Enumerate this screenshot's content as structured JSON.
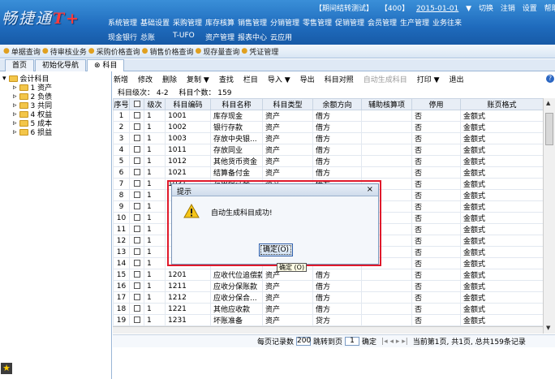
{
  "header": {
    "logo_text": "畅捷通",
    "logo_suffix": "T+",
    "info": [
      "【期间结转测试】",
      "【400】",
      "2015-01-01",
      "▼",
      "切换",
      "注销",
      "设置",
      "帮助"
    ],
    "menu_row1": [
      "系统管理",
      "基础设置",
      "采购管理",
      "库存核算",
      "销售管理",
      "分销管理",
      "零售管理",
      "促销管理",
      "会员管理",
      "生产管理",
      "业务往来"
    ],
    "menu_row2": [
      "现金银行",
      "总账",
      "T-UFO",
      "资产管理",
      "报表中心",
      "云应用"
    ]
  },
  "quickbar": [
    "单据查询",
    "待审核业务",
    "采购价格查询",
    "销售价格查询",
    "现存量查询",
    "凭证管理"
  ],
  "tabs": [
    "首页",
    "初始化导航",
    "科目"
  ],
  "tree": {
    "root": "会计科目",
    "items": [
      "1 资产",
      "2 负债",
      "3 共同",
      "4 权益",
      "5 成本",
      "6 损益"
    ]
  },
  "toolbar": {
    "items": [
      "新增",
      "修改",
      "删除",
      "复制 ▼",
      "查找",
      "栏目",
      "导入 ▼",
      "导出",
      "科目对照",
      "自动生成科目",
      "打印 ▼",
      "退出"
    ],
    "help_label": "?"
  },
  "summary": {
    "levels": "科目级次： 4-2",
    "count": "科目个数： 159"
  },
  "table": {
    "columns": [
      "序号",
      "",
      "级次",
      "科目编码",
      "科目名称",
      "科目类型",
      "余额方向",
      "辅助核算项",
      "停用",
      "账页格式"
    ],
    "rows": [
      [
        "1",
        "1",
        "1001",
        "库存现金",
        "资产",
        "借方",
        "",
        "否",
        "金额式"
      ],
      [
        "2",
        "1",
        "1002",
        "银行存款",
        "资产",
        "借方",
        "",
        "否",
        "金额式"
      ],
      [
        "3",
        "1",
        "1003",
        "存放中央银...",
        "资产",
        "借方",
        "",
        "否",
        "金额式"
      ],
      [
        "4",
        "1",
        "1011",
        "存放同业",
        "资产",
        "借方",
        "",
        "否",
        "金额式"
      ],
      [
        "5",
        "1",
        "1012",
        "其他货币资金",
        "资产",
        "借方",
        "",
        "否",
        "金额式"
      ],
      [
        "6",
        "1",
        "1021",
        "结算备付金",
        "资产",
        "借方",
        "",
        "否",
        "金额式"
      ],
      [
        "7",
        "1",
        "1031",
        "存出保证金",
        "资产",
        "借方",
        "",
        "否",
        "金额式"
      ],
      [
        "8",
        "1",
        "",
        "",
        "",
        "",
        "",
        "否",
        "金额式"
      ],
      [
        "9",
        "1",
        "",
        "",
        "",
        "",
        "",
        "否",
        "金额式"
      ],
      [
        "10",
        "1",
        "",
        "",
        "",
        "",
        "",
        "否",
        "金额式"
      ],
      [
        "11",
        "1",
        "",
        "",
        "",
        "",
        "单位",
        "否",
        "金额式"
      ],
      [
        "12",
        "1",
        "",
        "",
        "",
        "",
        "单位",
        "否",
        "金额式"
      ],
      [
        "13",
        "1",
        "",
        "",
        "",
        "",
        "",
        "否",
        "金额式"
      ],
      [
        "14",
        "1",
        "",
        "",
        "",
        "",
        "",
        "否",
        "金额式"
      ],
      [
        "15",
        "1",
        "1201",
        "应收代位追偿款",
        "资产",
        "借方",
        "",
        "否",
        "金额式"
      ],
      [
        "16",
        "1",
        "1211",
        "应收分保账款",
        "资产",
        "借方",
        "",
        "否",
        "金额式"
      ],
      [
        "17",
        "1",
        "1212",
        "应收分保合...",
        "资产",
        "借方",
        "",
        "否",
        "金额式"
      ],
      [
        "18",
        "1",
        "1221",
        "其他应收款",
        "资产",
        "借方",
        "",
        "否",
        "金额式"
      ],
      [
        "19",
        "1",
        "1231",
        "坏账准备",
        "资产",
        "贷方",
        "",
        "否",
        "金额式"
      ],
      [
        "20",
        "1",
        "1301",
        "贴现资产",
        "资产",
        "借方",
        "",
        "否",
        "金额式"
      ],
      [
        "21",
        "1",
        "1302",
        "拆出资金",
        "资产",
        "借方",
        "",
        "否",
        "金额式"
      ]
    ]
  },
  "footer": {
    "per_page_label": "每页记录数",
    "per_page": "200",
    "jump_label": "跳转到页",
    "jump_page": "1",
    "confirm": "确定",
    "status": "当前第1页, 共1页, 总共159条记录"
  },
  "dialog": {
    "title": "提示",
    "message": "自动生成科目成功!",
    "ok_label": "确定(O)",
    "tooltip": "确定 (O)"
  }
}
